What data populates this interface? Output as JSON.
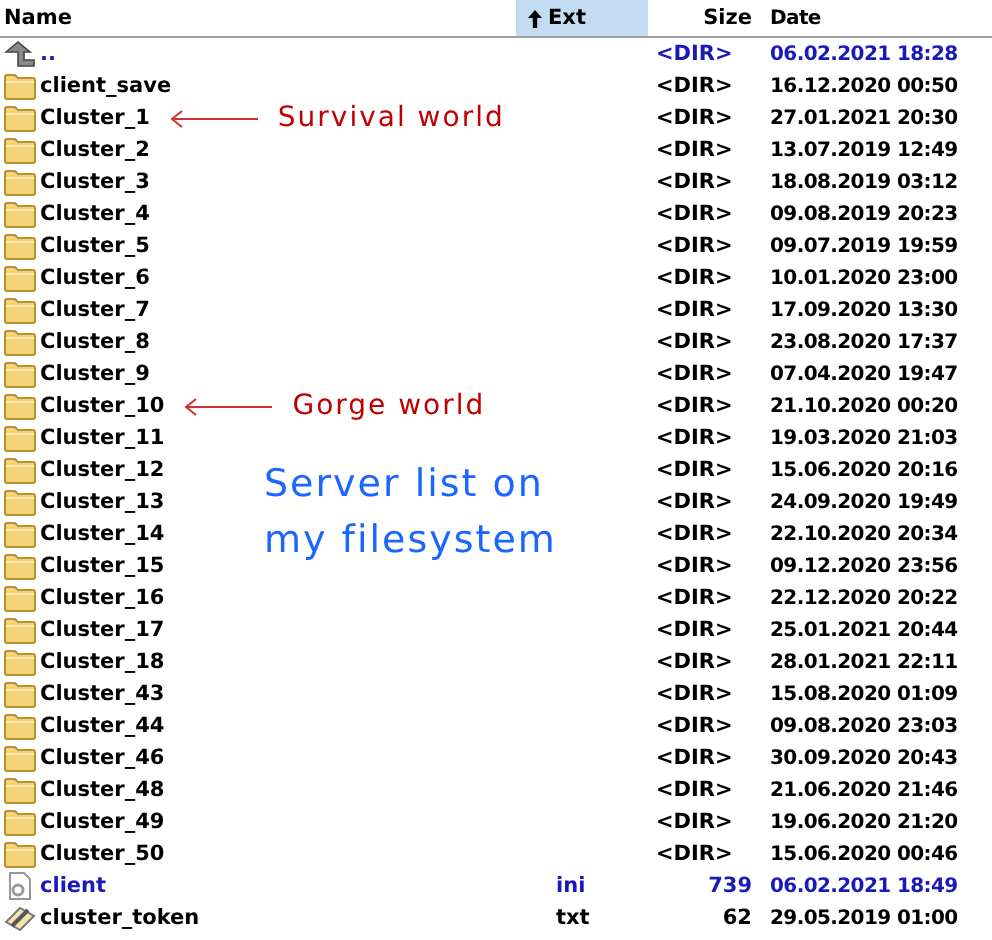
{
  "columns": [
    {
      "label": "Name",
      "sorted": false
    },
    {
      "label": "Ext",
      "sorted": true
    },
    {
      "label": "Size",
      "sorted": false
    },
    {
      "label": "Date",
      "sorted": false
    }
  ],
  "rows": [
    {
      "kind": "up",
      "name": "..",
      "size": "<DIR>",
      "date": "06.02.2021 18:28",
      "highlighted": true
    },
    {
      "kind": "folder",
      "name": "client_save",
      "size": "<DIR>",
      "date": "16.12.2020 00:50",
      "highlighted": false
    },
    {
      "kind": "folder",
      "name": "Cluster_1",
      "size": "<DIR>",
      "date": "27.01.2021 20:30",
      "highlighted": false,
      "annotation": "Survival world"
    },
    {
      "kind": "folder",
      "name": "Cluster_2",
      "size": "<DIR>",
      "date": "13.07.2019 12:49",
      "highlighted": false
    },
    {
      "kind": "folder",
      "name": "Cluster_3",
      "size": "<DIR>",
      "date": "18.08.2019 03:12",
      "highlighted": false
    },
    {
      "kind": "folder",
      "name": "Cluster_4",
      "size": "<DIR>",
      "date": "09.08.2019 20:23",
      "highlighted": false
    },
    {
      "kind": "folder",
      "name": "Cluster_5",
      "size": "<DIR>",
      "date": "09.07.2019 19:59",
      "highlighted": false
    },
    {
      "kind": "folder",
      "name": "Cluster_6",
      "size": "<DIR>",
      "date": "10.01.2020 23:00",
      "highlighted": false
    },
    {
      "kind": "folder",
      "name": "Cluster_7",
      "size": "<DIR>",
      "date": "17.09.2020 13:30",
      "highlighted": false
    },
    {
      "kind": "folder",
      "name": "Cluster_8",
      "size": "<DIR>",
      "date": "23.08.2020 17:37",
      "highlighted": false
    },
    {
      "kind": "folder",
      "name": "Cluster_9",
      "size": "<DIR>",
      "date": "07.04.2020 19:47",
      "highlighted": false
    },
    {
      "kind": "folder",
      "name": "Cluster_10",
      "size": "<DIR>",
      "date": "21.10.2020 00:20",
      "highlighted": false,
      "annotation": "Gorge world"
    },
    {
      "kind": "folder",
      "name": "Cluster_11",
      "size": "<DIR>",
      "date": "19.03.2020 21:03",
      "highlighted": false
    },
    {
      "kind": "folder",
      "name": "Cluster_12",
      "size": "<DIR>",
      "date": "15.06.2020 20:16",
      "highlighted": false
    },
    {
      "kind": "folder",
      "name": "Cluster_13",
      "size": "<DIR>",
      "date": "24.09.2020 19:49",
      "highlighted": false
    },
    {
      "kind": "folder",
      "name": "Cluster_14",
      "size": "<DIR>",
      "date": "22.10.2020 20:34",
      "highlighted": false
    },
    {
      "kind": "folder",
      "name": "Cluster_15",
      "size": "<DIR>",
      "date": "09.12.2020 23:56",
      "highlighted": false
    },
    {
      "kind": "folder",
      "name": "Cluster_16",
      "size": "<DIR>",
      "date": "22.12.2020 20:22",
      "highlighted": false
    },
    {
      "kind": "folder",
      "name": "Cluster_17",
      "size": "<DIR>",
      "date": "25.01.2021 20:44",
      "highlighted": false
    },
    {
      "kind": "folder",
      "name": "Cluster_18",
      "size": "<DIR>",
      "date": "28.01.2021 22:11",
      "highlighted": false
    },
    {
      "kind": "folder",
      "name": "Cluster_43",
      "size": "<DIR>",
      "date": "15.08.2020 01:09",
      "highlighted": false
    },
    {
      "kind": "folder",
      "name": "Cluster_44",
      "size": "<DIR>",
      "date": "09.08.2020 23:03",
      "highlighted": false
    },
    {
      "kind": "folder",
      "name": "Cluster_46",
      "size": "<DIR>",
      "date": "30.09.2020 20:43",
      "highlighted": false
    },
    {
      "kind": "folder",
      "name": "Cluster_48",
      "size": "<DIR>",
      "date": "21.06.2020 21:46",
      "highlighted": false
    },
    {
      "kind": "folder",
      "name": "Cluster_49",
      "size": "<DIR>",
      "date": "19.06.2020 21:20",
      "highlighted": false
    },
    {
      "kind": "folder",
      "name": "Cluster_50",
      "size": "<DIR>",
      "date": "15.06.2020 00:46",
      "highlighted": false
    },
    {
      "kind": "config",
      "name": "client",
      "ext": "ini",
      "size": "739",
      "date": "06.02.2021 18:49",
      "highlighted": true
    },
    {
      "kind": "text",
      "name": "cluster_token",
      "ext": "txt",
      "size": "62",
      "date": "29.05.2019 01:00",
      "highlighted": false
    }
  ],
  "caption": "Server list on my filesystem"
}
